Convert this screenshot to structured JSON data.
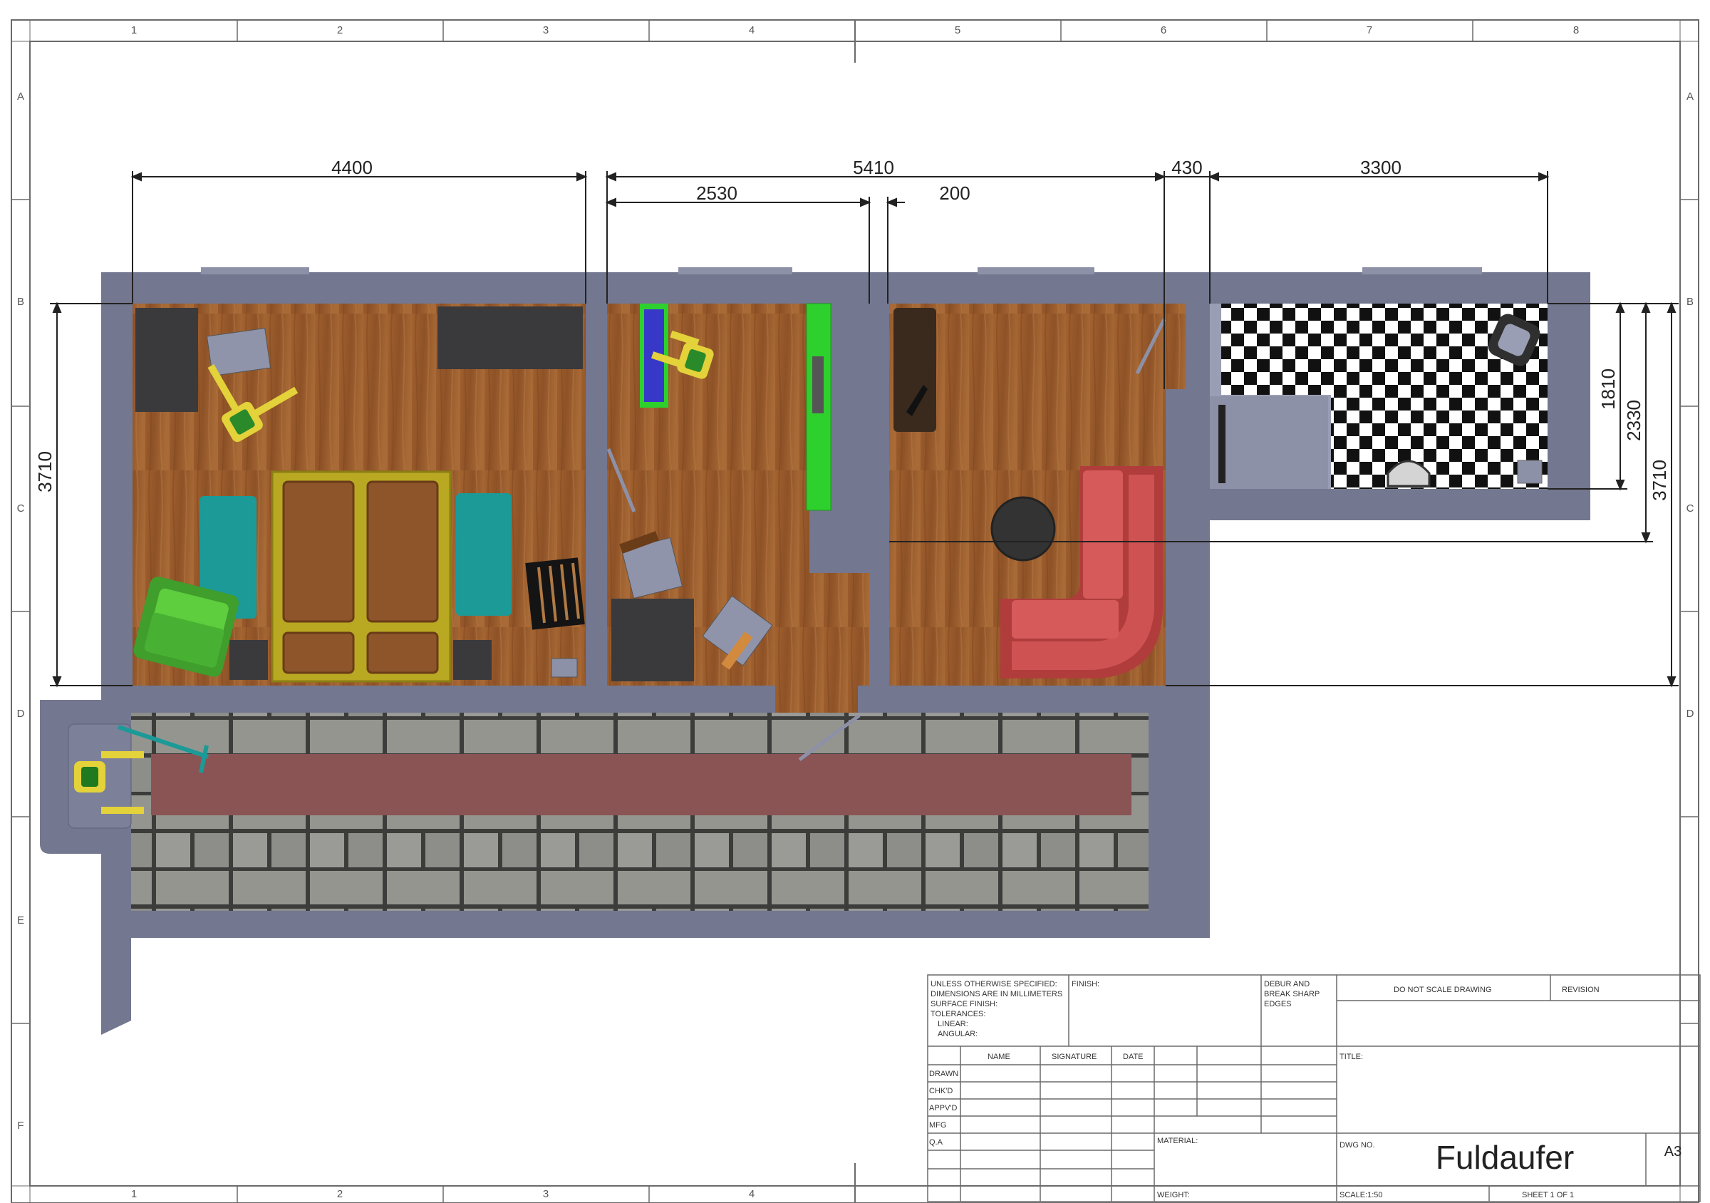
{
  "sheet": {
    "columns": [
      "1",
      "2",
      "3",
      "4",
      "5",
      "6",
      "7",
      "8"
    ],
    "rows": [
      "A",
      "B",
      "C",
      "D",
      "E",
      "F"
    ],
    "bottom_columns": [
      "1",
      "2",
      "3",
      "4"
    ]
  },
  "dimensions": {
    "d4400": "4400",
    "d5410": "5410",
    "d2530": "2530",
    "d200": "200",
    "d430": "430",
    "d3300": "3300",
    "d3710_left": "3710",
    "d1810": "1810",
    "d2330": "2330",
    "d3710_right": "3710"
  },
  "title_block": {
    "notes": [
      "UNLESS OTHERWISE SPECIFIED:",
      "DIMENSIONS ARE IN MILLIMETERS",
      "SURFACE FINISH:",
      "TOLERANCES:",
      "LINEAR:",
      "ANGULAR:"
    ],
    "finish": "FINISH:",
    "deburr": [
      "DEBUR AND",
      "BREAK SHARP",
      "EDGES"
    ],
    "do_not_scale": "DO NOT SCALE DRAWING",
    "revision": "REVISION",
    "col_name": "NAME",
    "col_signature": "SIGNATURE",
    "col_date": "DATE",
    "row_labels": [
      "DRAWN",
      "CHK'D",
      "APPV'D",
      "MFG",
      "Q.A"
    ],
    "title": "TITLE:",
    "material": "MATERIAL:",
    "dwg_no": "DWG NO.",
    "drawing_name": "Fuldaufer",
    "size": "A3",
    "weight": "WEIGHT:",
    "scale": "SCALE:1:50",
    "sheet": "SHEET 1 OF 1"
  },
  "colors": {
    "wall": "#73778f",
    "wood": "#9a5a2c",
    "paving": "#8e8e8b",
    "carpet_runner": "#8a5454",
    "sofa_red": "#c94a4a",
    "teal": "#1b9a97",
    "green_chair": "#56c23a",
    "robot_yellow": "#e3d23a",
    "dark_furniture": "#3a3a3c",
    "counter_green": "#2ed02e",
    "frame_line": "#6a6a6a"
  }
}
